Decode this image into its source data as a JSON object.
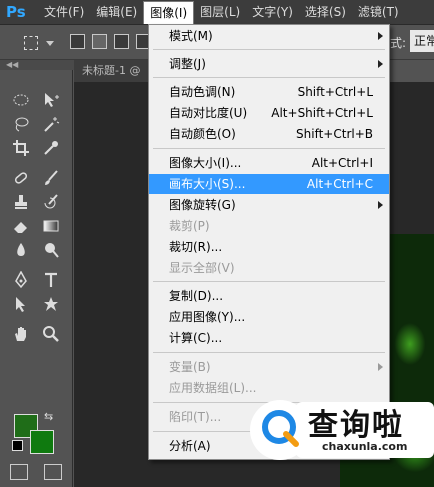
{
  "app": {
    "logo_text": "Ps",
    "menu": [
      {
        "label": "文件(F)"
      },
      {
        "label": "编辑(E)"
      },
      {
        "label": "图像(I)",
        "active": true
      },
      {
        "label": "图层(L)"
      },
      {
        "label": "文字(Y)"
      },
      {
        "label": "选择(S)"
      },
      {
        "label": "滤镜(T)"
      }
    ]
  },
  "options_bar": {
    "style_label": "式:",
    "style_value": "正常"
  },
  "document": {
    "tab_title": "未标题-1 @"
  },
  "toolbar": {
    "grip": "◀◀",
    "tools": [
      {
        "name": "elliptical-marquee-icon"
      },
      {
        "name": "move-icon"
      },
      {
        "name": "lasso-icon"
      },
      {
        "name": "magic-wand-icon"
      },
      {
        "name": "crop-icon"
      },
      {
        "name": "eyedropper-icon"
      },
      {
        "name": "healing-brush-icon"
      },
      {
        "name": "brush-icon"
      },
      {
        "name": "clone-stamp-icon"
      },
      {
        "name": "history-brush-icon"
      },
      {
        "name": "eraser-icon"
      },
      {
        "name": "gradient-icon"
      },
      {
        "name": "blur-icon"
      },
      {
        "name": "dodge-icon"
      },
      {
        "name": "pen-icon"
      },
      {
        "name": "type-icon"
      },
      {
        "name": "path-selection-icon"
      },
      {
        "name": "shape-icon"
      },
      {
        "name": "hand-icon"
      },
      {
        "name": "zoom-icon"
      }
    ],
    "foreground_color": "#1f6d18",
    "background_color": "#0f7a0f"
  },
  "image_menu": {
    "items": [
      {
        "label": "模式(M)",
        "shortcut": "",
        "submenu": true,
        "disabled": false
      },
      {
        "label": "调整(J)",
        "shortcut": "",
        "submenu": true,
        "disabled": false
      },
      {
        "label": "自动色调(N)",
        "shortcut": "Shift+Ctrl+L",
        "submenu": false,
        "disabled": false
      },
      {
        "label": "自动对比度(U)",
        "shortcut": "Alt+Shift+Ctrl+L",
        "submenu": false,
        "disabled": false
      },
      {
        "label": "自动颜色(O)",
        "shortcut": "Shift+Ctrl+B",
        "submenu": false,
        "disabled": false
      },
      {
        "label": "图像大小(I)...",
        "shortcut": "Alt+Ctrl+I",
        "submenu": false,
        "disabled": false
      },
      {
        "label": "画布大小(S)...",
        "shortcut": "Alt+Ctrl+C",
        "submenu": false,
        "disabled": false,
        "highlighted": true
      },
      {
        "label": "图像旋转(G)",
        "shortcut": "",
        "submenu": true,
        "disabled": false
      },
      {
        "label": "裁剪(P)",
        "shortcut": "",
        "submenu": false,
        "disabled": true
      },
      {
        "label": "裁切(R)...",
        "shortcut": "",
        "submenu": false,
        "disabled": false
      },
      {
        "label": "显示全部(V)",
        "shortcut": "",
        "submenu": false,
        "disabled": true
      },
      {
        "label": "复制(D)...",
        "shortcut": "",
        "submenu": false,
        "disabled": false
      },
      {
        "label": "应用图像(Y)...",
        "shortcut": "",
        "submenu": false,
        "disabled": false
      },
      {
        "label": "计算(C)...",
        "shortcut": "",
        "submenu": false,
        "disabled": false
      },
      {
        "label": "变量(B)",
        "shortcut": "",
        "submenu": true,
        "disabled": true
      },
      {
        "label": "应用数据组(L)...",
        "shortcut": "",
        "submenu": false,
        "disabled": true
      },
      {
        "label": "陷印(T)...",
        "shortcut": "",
        "submenu": false,
        "disabled": true
      },
      {
        "label": "分析(A)",
        "shortcut": "",
        "submenu": true,
        "disabled": false
      }
    ]
  },
  "watermark": {
    "name": "查询啦",
    "url": "chaxunla.com"
  },
  "colors": {
    "highlight": "#3399ff",
    "accent_ps": "#31a8ff",
    "watermark_blue": "#1e88e5",
    "watermark_orange": "#f39c12"
  }
}
